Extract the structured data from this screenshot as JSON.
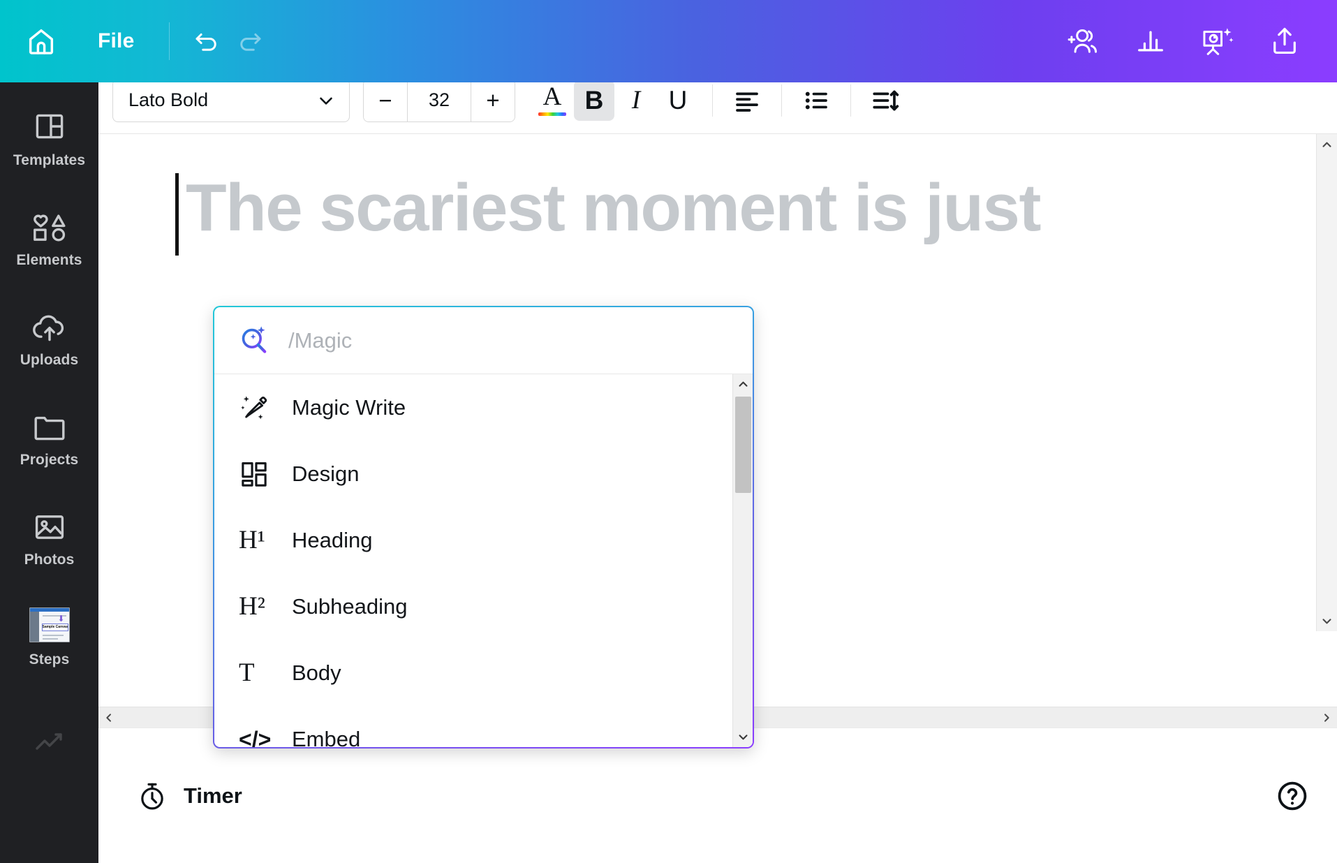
{
  "header": {
    "home_label": "Home",
    "file_label": "File",
    "undo_label": "Undo",
    "redo_label": "Redo",
    "right_actions": [
      {
        "name": "add-collaborator-icon",
        "label": "Share with people"
      },
      {
        "name": "analytics-icon",
        "label": "Insights"
      },
      {
        "name": "present-icon",
        "label": "Present"
      },
      {
        "name": "share-icon",
        "label": "Share"
      }
    ],
    "gradient_from": "#00c4cc",
    "gradient_mid": "#4a62e0",
    "gradient_to": "#8b3dff"
  },
  "sidebar": {
    "items": [
      {
        "label": "Templates",
        "icon": "templates-icon"
      },
      {
        "label": "Elements",
        "icon": "elements-icon"
      },
      {
        "label": "Uploads",
        "icon": "uploads-icon"
      },
      {
        "label": "Projects",
        "icon": "projects-icon"
      },
      {
        "label": "Photos",
        "icon": "photos-icon"
      },
      {
        "label": "Steps",
        "icon": "steps-thumbnail"
      }
    ],
    "steps_thumbnail_caption": "Sample Canvas",
    "partial_item": {
      "label": "",
      "icon": "chart-icon"
    }
  },
  "toolbar": {
    "font_family": "Lato Bold",
    "font_size": "32",
    "decrease_label": "−",
    "increase_label": "+",
    "text_color_label": "A",
    "bold_label": "B",
    "bold_active": true,
    "italic_label": "I",
    "underline_label": "U",
    "align_label": "Align left",
    "list_label": "Bullet list",
    "spacing_label": "Spacing"
  },
  "canvas": {
    "title_text": "The scariest moment is just",
    "title_color": "#c5c9cd",
    "caret_visible": true
  },
  "magic_menu": {
    "search_placeholder": "/Magic",
    "search_value": "",
    "search_icon": "magic-search-icon",
    "items": [
      {
        "label": "Magic Write",
        "icon": "magic-write-icon"
      },
      {
        "label": "Design",
        "icon": "design-grid-icon"
      },
      {
        "label": "Heading",
        "icon": "heading-h1-icon",
        "glyph": "H¹"
      },
      {
        "label": "Subheading",
        "icon": "subheading-h2-icon",
        "glyph": "H²"
      },
      {
        "label": "Body",
        "icon": "body-text-icon",
        "glyph": "T"
      },
      {
        "label": "Embed",
        "icon": "embed-code-icon",
        "glyph": "</>"
      }
    ],
    "border_gradient_from": "#22c8d8",
    "border_gradient_to": "#8b3dff"
  },
  "bottom_bar": {
    "timer_label": "Timer",
    "timer_icon": "stopwatch-icon",
    "help_label": "Help",
    "help_icon": "help-circle-icon"
  },
  "scrollbars": {
    "canvas_up": "∧",
    "canvas_down": "∨",
    "canvas_left": "‹",
    "canvas_right": "›",
    "dropdown_up": "∧",
    "dropdown_down": "∨"
  }
}
